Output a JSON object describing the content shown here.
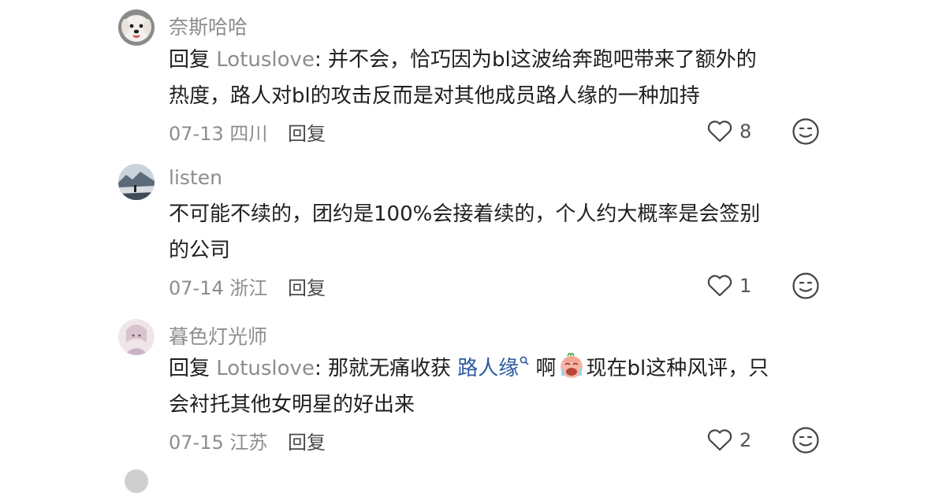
{
  "comments": [
    {
      "username": "奈斯哈哈",
      "reply_prefix": "回复 ",
      "reply_target": "Lotuslove",
      "reply_colon": ": ",
      "line1": "并不会，恰巧因为bl这波给奔跑吧带来了额外的",
      "line2": "热度，路人对bl的攻击反而是对其他成员路人缘的一种加持",
      "date": "07-13",
      "location": "四川",
      "reply_label": "回复",
      "likes": "8",
      "avatar_icon": "white-dog-avatar-icon"
    },
    {
      "username": "listen",
      "line1": "不可能不续的，团约是100%会接着续的，个人约大概率是会签别",
      "line2": "的公司",
      "date": "07-14",
      "location": "浙江",
      "reply_label": "回复",
      "likes": "1",
      "avatar_icon": "landscape-avatar-icon"
    },
    {
      "username": "暮色灯光师",
      "reply_prefix": "回复 ",
      "reply_target": "Lotuslove",
      "reply_colon": ": ",
      "line1_a": "那就无痛收获 ",
      "line1_link": "路人缘",
      "line1_b": " 啊",
      "line1_c": "现在bl这种风评，只",
      "line2": "会衬托其他女明星的好出来",
      "date": "07-15",
      "location": "江苏",
      "reply_label": "回复",
      "likes": "2",
      "avatar_icon": "illustration-avatar-icon",
      "inline_emoji": "crying-face-emoji-icon",
      "search_icon": "search-icon"
    }
  ],
  "colors": {
    "meta_gray": "#8d8d8d",
    "text_dark": "#1f1f1f",
    "link_blue": "#2c5aa0"
  }
}
